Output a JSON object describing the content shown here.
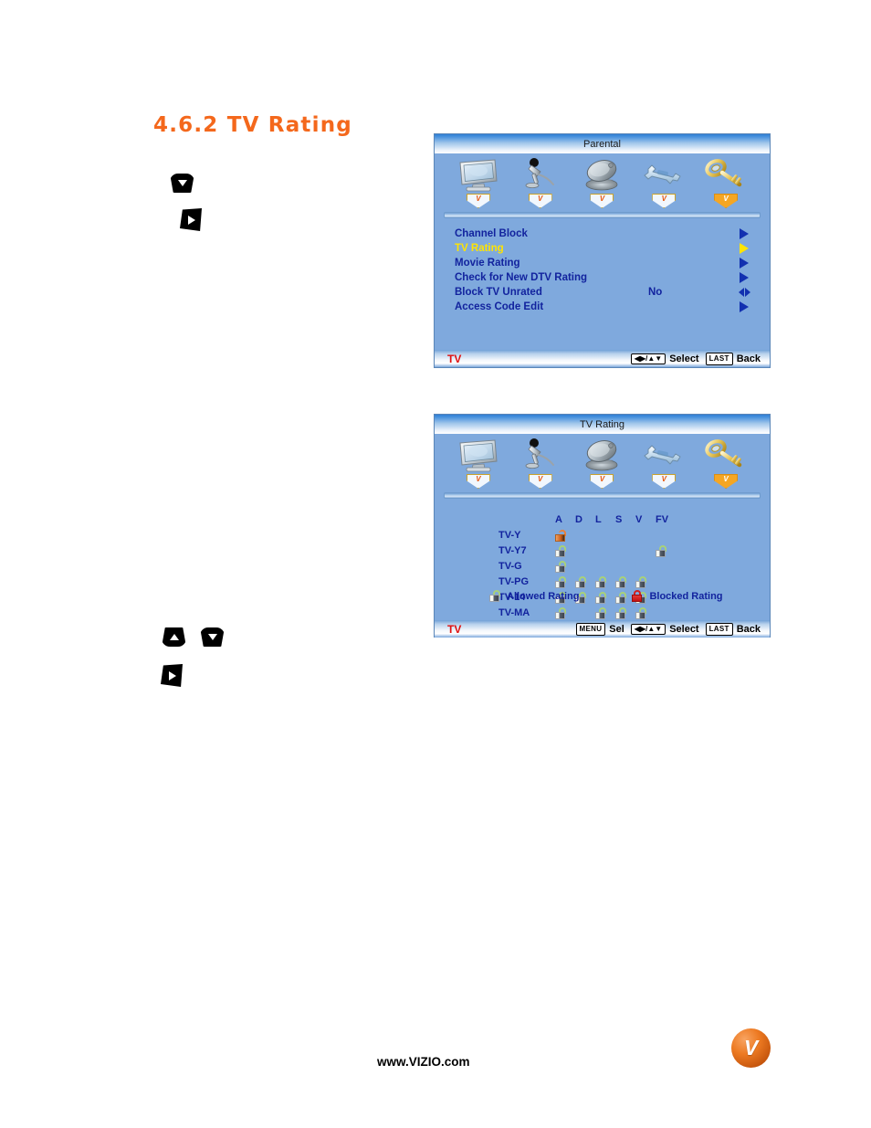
{
  "page": {
    "heading": "4.6.2 TV Rating",
    "footer_url": "www.VIZIO.com",
    "logo_letter": "V"
  },
  "colors": {
    "heading_orange": "#f4681c",
    "osd_background": "#7fa9dd",
    "menu_text_blue": "#12239e",
    "selected_yellow": "#ffe400",
    "source_red": "#e01010",
    "blocked_red": "#d02020"
  },
  "icon_tabs": [
    {
      "name": "tv-picture-icon",
      "label": "",
      "active": false
    },
    {
      "name": "microphone-audio-icon",
      "label": "",
      "active": false
    },
    {
      "name": "satellite-dish-tuner-icon",
      "label": "",
      "active": false
    },
    {
      "name": "wrench-setup-icon",
      "label": "",
      "active": false
    },
    {
      "name": "key-parental-icon",
      "label": "",
      "active": true
    }
  ],
  "badge_letter": "V",
  "parental_panel": {
    "title": "Parental",
    "source_label": "TV",
    "menu_items": [
      {
        "label": "Channel Block",
        "value": "",
        "arrow": "right",
        "selected": false
      },
      {
        "label": "TV Rating",
        "value": "",
        "arrow": "right",
        "selected": true
      },
      {
        "label": "Movie Rating",
        "value": "",
        "arrow": "right",
        "selected": false
      },
      {
        "label": "Check for New DTV Rating",
        "value": "",
        "arrow": "right",
        "selected": false
      },
      {
        "label": "Block TV Unrated",
        "value": "No",
        "arrow": "leftright",
        "selected": false
      },
      {
        "label": "Access Code Edit",
        "value": "",
        "arrow": "right",
        "selected": false
      }
    ],
    "footer_hints": [
      {
        "key": "◀▶/▲▼",
        "key_style": "nav",
        "label": "Select"
      },
      {
        "key": "LAST",
        "key_style": "cap",
        "label": "Back"
      }
    ]
  },
  "tvrating_panel": {
    "title": "TV Rating",
    "source_label": "TV",
    "columns": [
      "A",
      "D",
      "L",
      "S",
      "V",
      "FV"
    ],
    "rows": [
      {
        "label": "TV-Y",
        "cells": [
          "open-orange",
          "",
          "",
          "",
          "",
          ""
        ]
      },
      {
        "label": "TV-Y7",
        "cells": [
          "allowed",
          "",
          "",
          "",
          "",
          "allowed"
        ]
      },
      {
        "label": "TV-G",
        "cells": [
          "allowed",
          "",
          "",
          "",
          "",
          ""
        ]
      },
      {
        "label": "TV-PG",
        "cells": [
          "allowed",
          "allowed",
          "allowed",
          "allowed",
          "allowed",
          ""
        ]
      },
      {
        "label": "TV-14",
        "cells": [
          "allowed",
          "allowed",
          "allowed",
          "allowed",
          "allowed",
          ""
        ]
      },
      {
        "label": "TV-MA",
        "cells": [
          "allowed",
          "",
          "allowed",
          "allowed",
          "allowed",
          ""
        ]
      }
    ],
    "legend": {
      "allowed_label": "Allowed Rating",
      "blocked_label": "Blocked Rating"
    },
    "footer_hints": [
      {
        "key": "MENU",
        "key_style": "cap",
        "label": "Sel"
      },
      {
        "key": "◀▶/▲▼",
        "key_style": "nav",
        "label": "Select"
      },
      {
        "key": "LAST",
        "key_style": "cap",
        "label": "Back"
      }
    ]
  },
  "remote_buttons": [
    {
      "name": "remote-down-button-step1",
      "glyph": "down"
    },
    {
      "name": "remote-right-button-step2",
      "glyph": "right"
    },
    {
      "name": "remote-up-button-step3",
      "glyph": "up"
    },
    {
      "name": "remote-down-button-step3",
      "glyph": "down"
    },
    {
      "name": "remote-right-button-step4",
      "glyph": "right"
    }
  ]
}
